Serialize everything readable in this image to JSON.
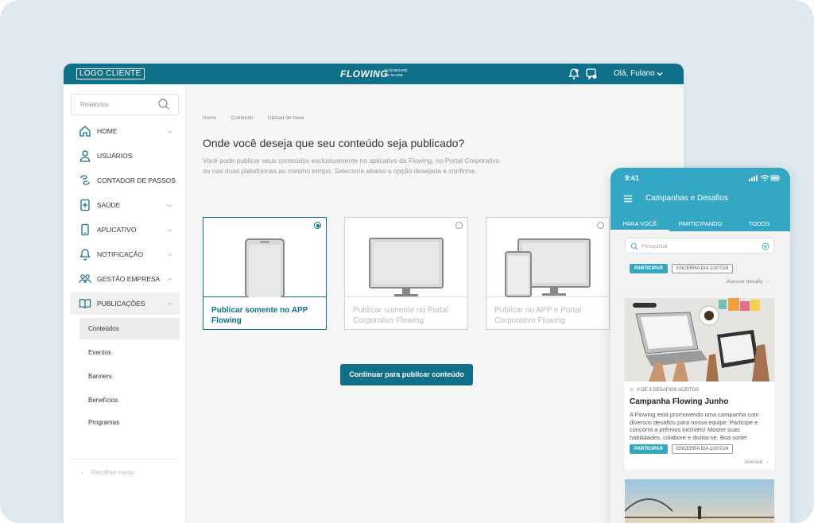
{
  "header": {
    "logo": "LOGO CLIENTE",
    "brand": "FLOWING",
    "brand_sub_1": "DASHBOARD",
    "brand_sub_2": "DE SAÚDE",
    "greeting": "Olá, Fulano"
  },
  "sidebar": {
    "search_placeholder": "Relatórios",
    "items": [
      {
        "label": "HOME",
        "icon": "home-icon"
      },
      {
        "label": "USUÁRIOS",
        "icon": "user-icon"
      },
      {
        "label": "CONTADOR DE PASSOS",
        "icon": "footsteps-icon"
      },
      {
        "label": "SAÚDE",
        "icon": "health-icon"
      },
      {
        "label": "APLICATIVO",
        "icon": "phone-icon"
      },
      {
        "label": "NOTIFICAÇÃO",
        "icon": "bell-icon"
      },
      {
        "label": "GESTÃO EMPRESA",
        "icon": "team-icon"
      },
      {
        "label": "PUBLICAÇÕES",
        "icon": "book-icon"
      }
    ],
    "subitems": [
      "Conteúdos",
      "Eventos",
      "Banners",
      "Benefícios",
      "Programas"
    ],
    "collapse_label": "Recolher menu"
  },
  "main": {
    "breadcrumb": [
      "Home",
      "Conteúdo",
      "Upload de base"
    ],
    "title": "Onde você deseja que seu conteúdo seja publicado?",
    "description": "Você pode publicar seus conteúdos exclusivamente no aplicativo da Flowing, no Portal Corporativo ou nas duas plataformas ao mesmo tempo. Selecione abaixo a opção desejada e confirme.",
    "options": [
      {
        "line1": "Publicar somente no APP",
        "line2": "Flowing",
        "selected": true
      },
      {
        "line1": "Publicar somente no Portal",
        "line2": "Corporativo Flowing",
        "selected": false
      },
      {
        "line1": "Publicar no APP e Portal",
        "line2": "Corporativo Flowing",
        "selected": false
      }
    ],
    "cta": "Continuar para publicar conteúdo"
  },
  "phone": {
    "time": "9:41",
    "title": "Campanhas e Desafios",
    "tabs": [
      "PARA VOCÊ",
      "PARTICIPANDO",
      "TODOS"
    ],
    "search_placeholder": "Pesquisar",
    "card1": {
      "participate": "PARTICIPAR",
      "ends": "ENCERRA DIA 10/07/24",
      "access": "Acessar desafio →"
    },
    "card2": {
      "meta": "0 DE 3 DESAFIOS ACEITOS",
      "title": "Campanha Flowing Junho",
      "description": "A Flowing está promovendo uma campanha com diversos desafios para nossa equipe. Participe e concorra a prêmios incríveis! Mostre suas habilidades, colabore e divirta-se. Boa sorte!",
      "participate": "PARTICIPAR",
      "ends": "ENCERRA DIA 10/07/24",
      "access": "Acessar →"
    }
  },
  "colors": {
    "primary": "#10708a",
    "app_header": "#33a7c4",
    "background": "#dfeaf0"
  }
}
